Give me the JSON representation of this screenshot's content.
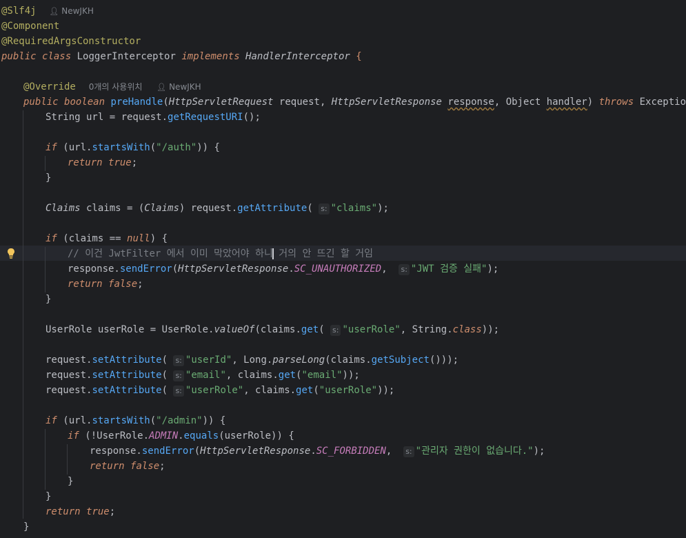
{
  "editor": {
    "author": "NewJKH",
    "usages_hint": "0개의 사용위치",
    "param_hint_label": "s:",
    "annotations": {
      "slf4j": "@Slf4j",
      "component": "@Component",
      "required_args": "@RequiredArgsConstructor",
      "override": "@Override"
    },
    "class_decl": {
      "public": "public",
      "class_kw": "class",
      "name": "LoggerInterceptor",
      "implements": "implements",
      "iface": "HandlerInterceptor",
      "brace": "{"
    },
    "method_decl": {
      "public": "public",
      "boolean": "boolean",
      "name": "preHandle",
      "p1_type": "HttpServletRequest",
      "p1_name": "request",
      "p2_type": "HttpServletResponse",
      "p2_name": "response",
      "p3_type": "Object",
      "p3_name": "handler",
      "throws": "throws",
      "exc": "Exception"
    },
    "strings": {
      "auth": "\"/auth\"",
      "claims": "\"claims\"",
      "jwt_fail": "\"JWT 검증 실패\"",
      "userRole": "\"userRole\"",
      "userId": "\"userId\"",
      "email": "\"email\"",
      "admin": "\"/admin\"",
      "forbidden": "\"관리자 권한이 없습니다.\""
    },
    "comment": {
      "before_caret": "// 이건 JwtFilter 에서 이미 막았어야 하니",
      "after_caret": " 거의 안 뜨긴 할 거임"
    },
    "fields": {
      "sc_unauthorized": "SC_UNAUTHORIZED",
      "sc_forbidden": "SC_FORBIDDEN",
      "admin": "ADMIN"
    }
  }
}
